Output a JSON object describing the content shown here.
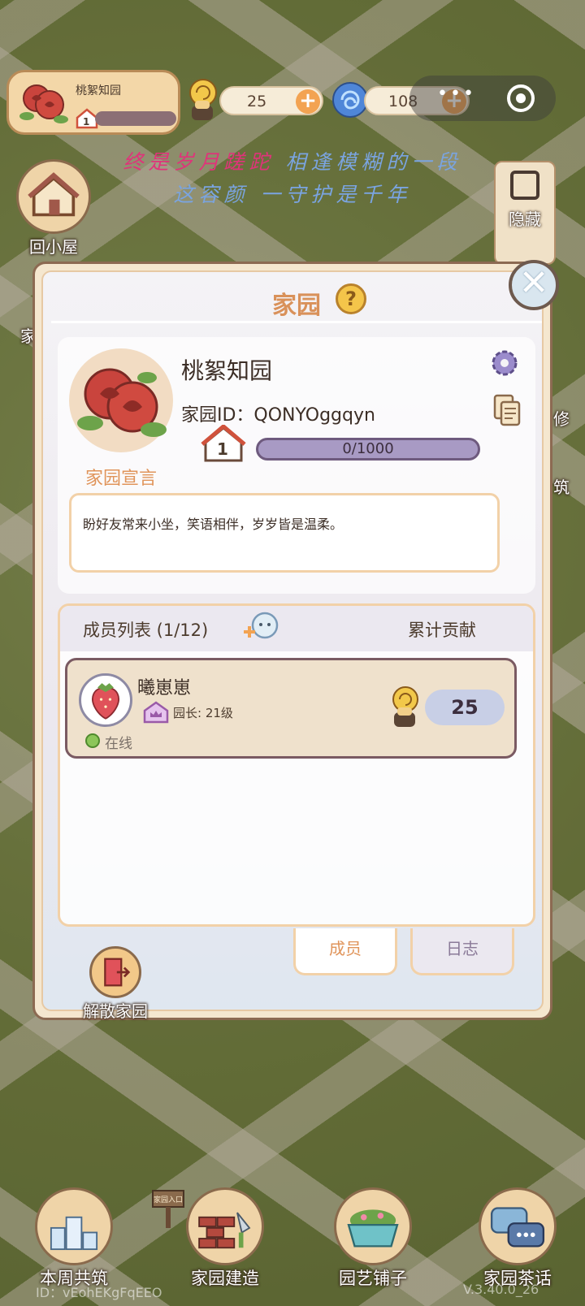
{
  "hud": {
    "home_name": "桃絮知园",
    "home_level": "1",
    "snail_count": "25",
    "gem_count": "108",
    "menu_dots": "•••",
    "poem_line1_a": "终是岁月蹉跎",
    "poem_line1_b": "相逢模糊的一段",
    "poem_line2": "这容颜 一守护是千年",
    "back_home_label": "回小屋",
    "hide_label": "隐藏",
    "side_partial_left": "家",
    "side_partial_right1": "修",
    "side_partial_right2": "筑"
  },
  "panel": {
    "title": "家园",
    "help": "?",
    "home_name": "桃絮知园",
    "home_id": "家园ID：QONYOggqyn",
    "level": "1",
    "exp": "0/1000",
    "declaration_label": "家园宣言",
    "declaration_text": "盼好友常来小坐，笑语相伴，岁岁皆是温柔。",
    "members_title": "成员列表 (1/12)",
    "contrib_title": "累计贡献",
    "members": [
      {
        "name": "曦崽崽",
        "role": "园长: 21级",
        "status": "在线",
        "contribution": "25"
      }
    ],
    "tab_members": "成员",
    "tab_log": "日志",
    "dissolve_label": "解散家园",
    "close": "✕"
  },
  "bottom": {
    "weekly": "本周共筑",
    "build": "家园建造",
    "shop": "园艺铺子",
    "tea": "家园茶话",
    "player_id": "ID：vEohEKgFqEEO",
    "version": "V.3.40.0_26",
    "sign_text": "家园入口"
  },
  "colors": {
    "accent": "#e0945a",
    "panel_bg": "#f5e7cf",
    "exp_bar": "#a89ac4",
    "online": "#8cc65a"
  }
}
